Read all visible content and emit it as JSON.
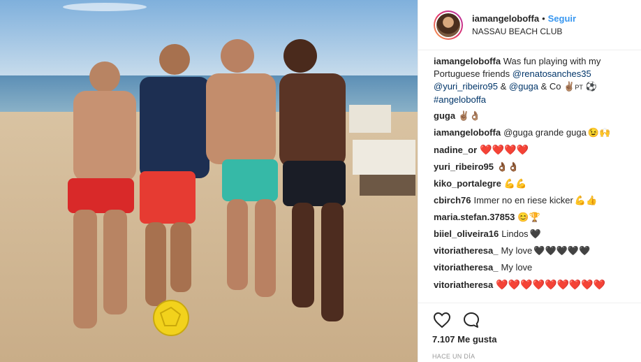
{
  "post": {
    "username": "iamangeloboffa",
    "separator": "•",
    "follow_label": "Seguir",
    "location": "NASSAU BEACH CLUB",
    "photo_alt": "iamangeloboffa photo"
  },
  "caption": {
    "username": "iamangeloboffa",
    "text_1": "Was fun playing with my Portuguese friends",
    "mention_1": "@renatosanches35",
    "mention_2": "@yuri_ribeiro95",
    "amp_1": "&",
    "mention_3": "@guga",
    "amp_2": "& Co",
    "tag": "#angeloboffa",
    "pt_label": "PT"
  },
  "comments": [
    {
      "username": "guga",
      "text": "",
      "emojis": [
        "✌🏽",
        "👌🏽"
      ]
    },
    {
      "username": "iamangeloboffa",
      "text": "@guga grande guga",
      "emojis": [
        "😉",
        "🙌"
      ]
    },
    {
      "username": "nadine_or",
      "text": "",
      "emojis": [
        "❤️",
        "❤️",
        "❤️",
        "❤️"
      ]
    },
    {
      "username": "yuri_ribeiro95",
      "text": "",
      "emojis": [
        "👌🏾",
        "👌🏾"
      ]
    },
    {
      "username": "kiko_portalegre",
      "text": "",
      "emojis": [
        "💪",
        "💪"
      ]
    },
    {
      "username": "cbirch76",
      "text": "Immer no en riese kicker",
      "emojis": [
        "💪",
        "👍"
      ]
    },
    {
      "username": "maria.stefan.37853",
      "text": "",
      "emojis": [
        "😊",
        "🏆"
      ]
    },
    {
      "username": "biiel_oliveira16",
      "text": "Lindos",
      "emojis": [
        "🖤"
      ]
    },
    {
      "username": "vitoriatheresa_",
      "text": "My love",
      "emojis": [
        "🖤",
        "🖤",
        "🖤",
        "🖤",
        "🖤"
      ]
    },
    {
      "username": "vitoriatheresa_",
      "text": "My love",
      "emojis": []
    },
    {
      "username": "vitoriatheresa",
      "text": "",
      "emojis": [
        "❤️",
        "❤️",
        "❤️",
        "❤️",
        "❤️",
        "❤️",
        "❤️",
        "❤️",
        "❤️"
      ]
    }
  ],
  "actions": {
    "likes_text": "7.107 Me gusta",
    "time_text": "HACE UN DÍA",
    "like_icon": "heart-outline-icon",
    "comment_icon": "comment-bubble-icon"
  },
  "colors": {
    "link": "#3897f0",
    "mention": "#003569",
    "heart": "#e0245e"
  }
}
